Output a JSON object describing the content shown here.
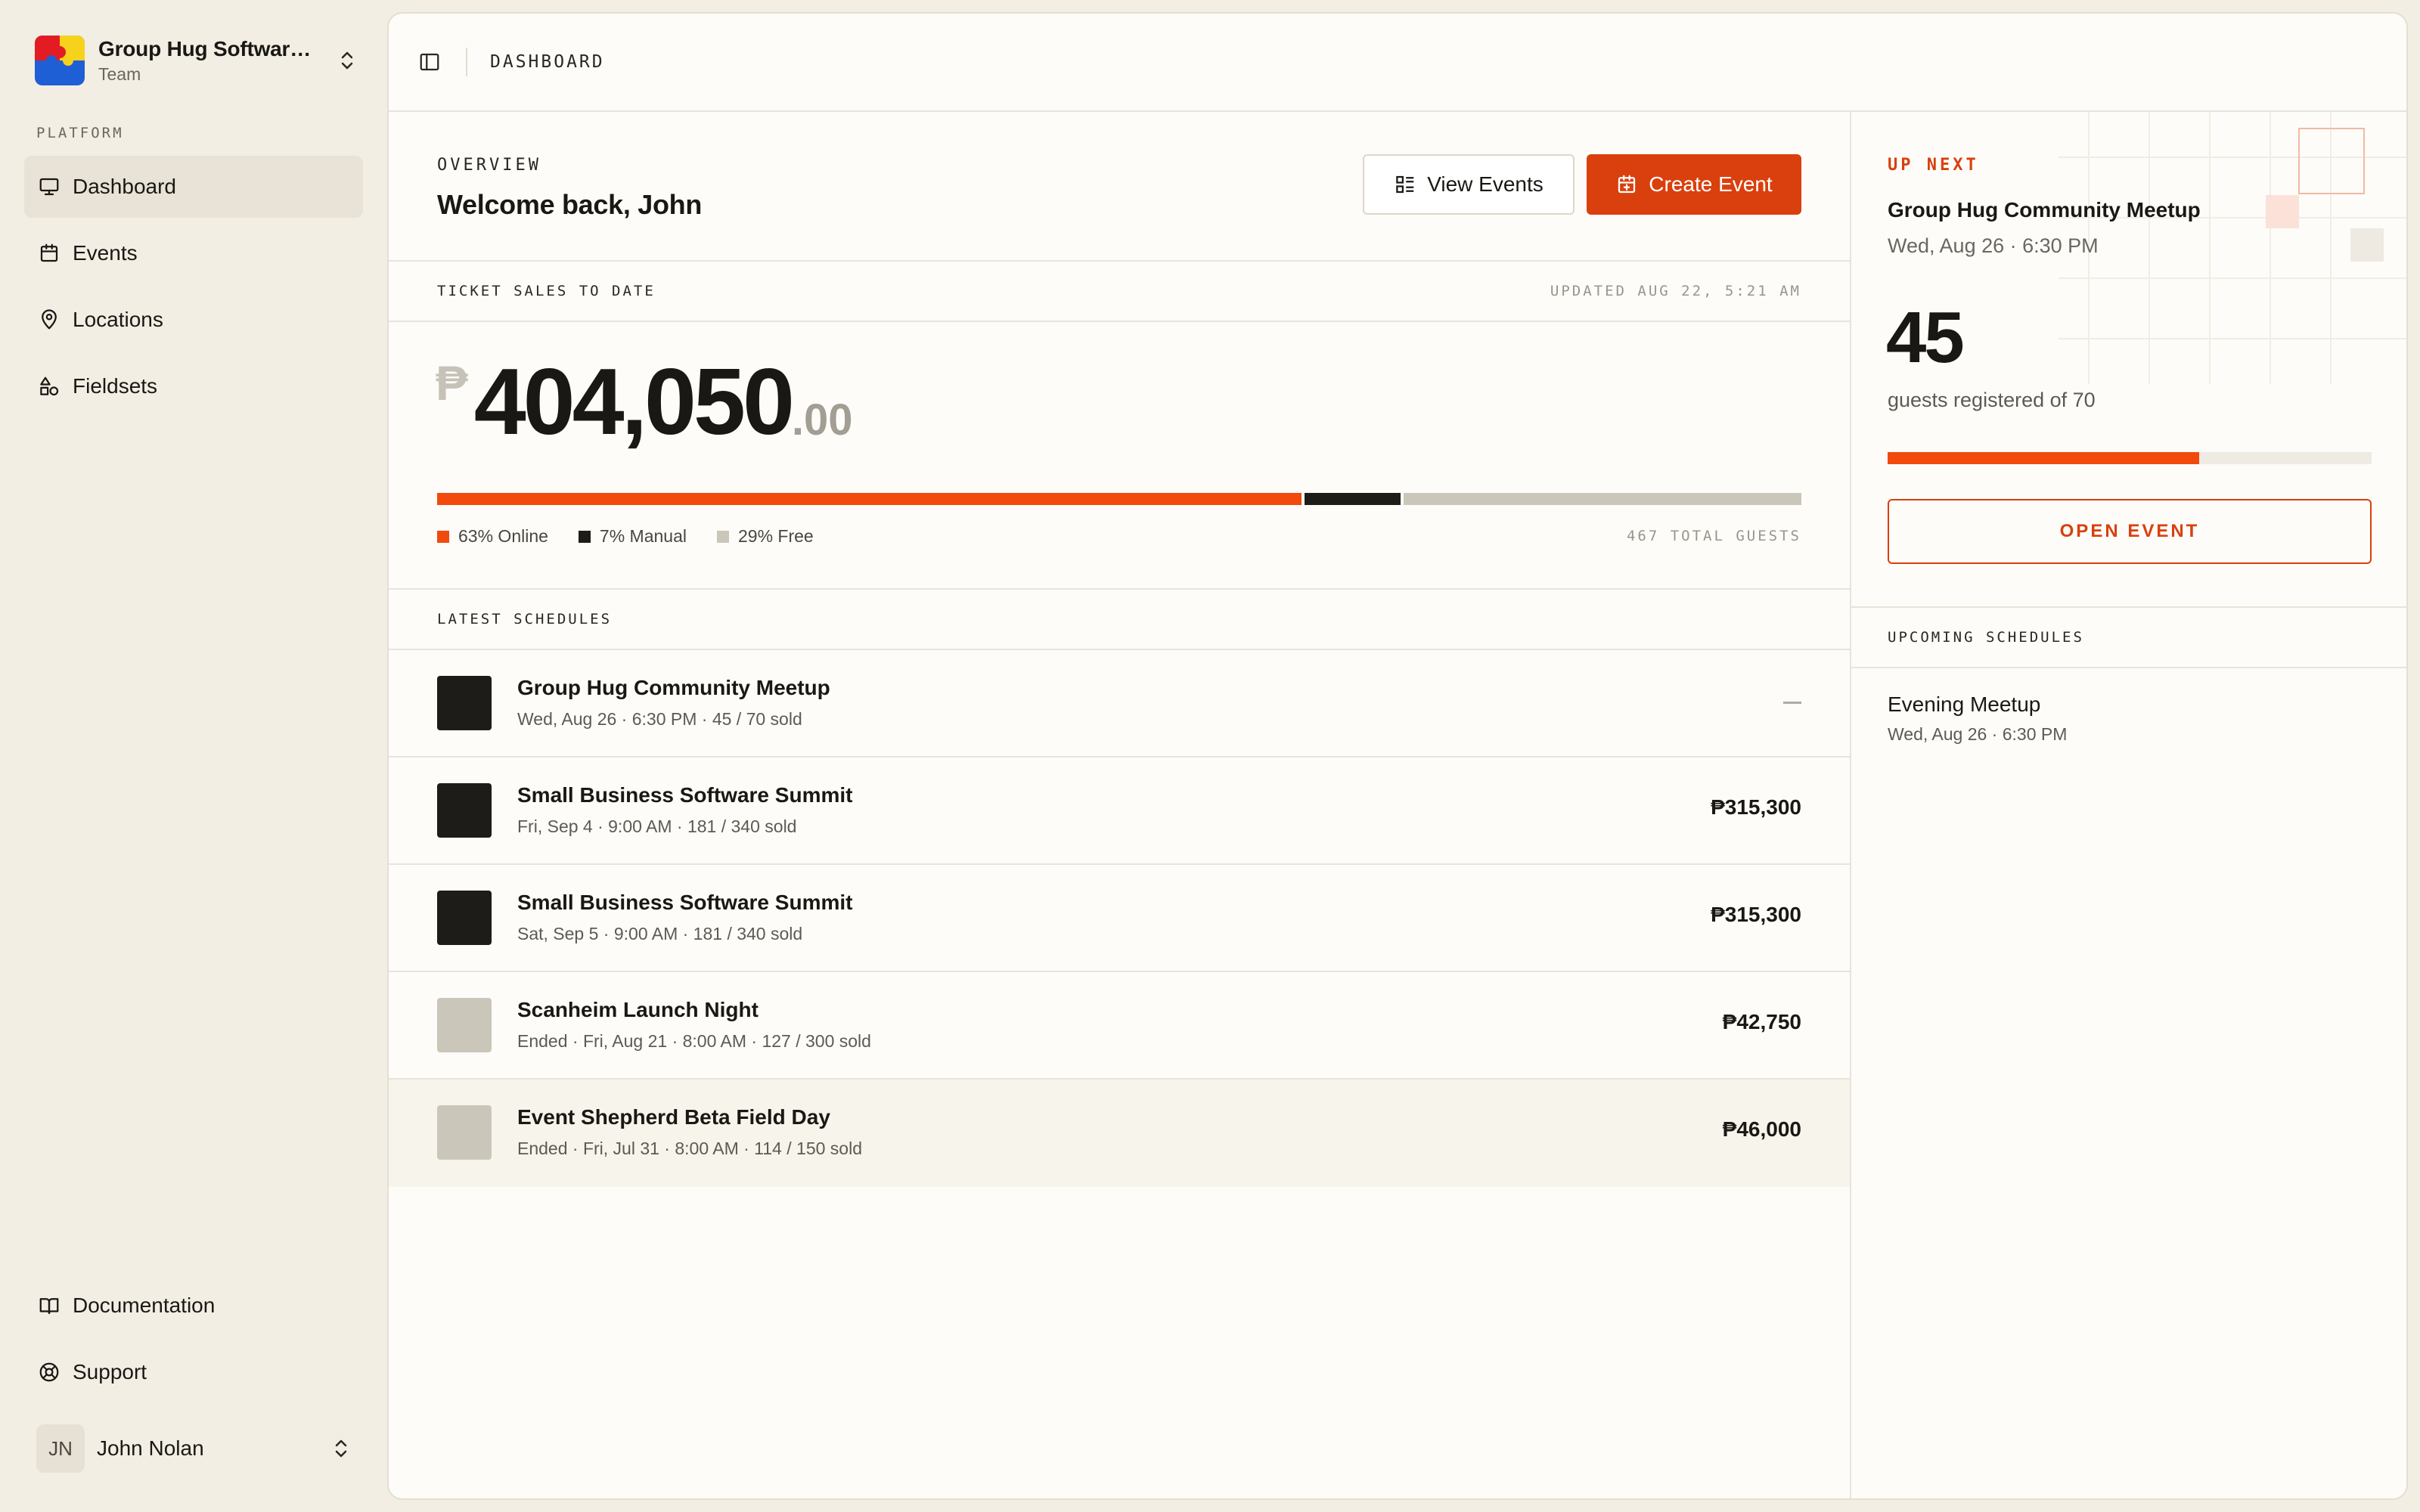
{
  "org": {
    "name": "Group Hug Software...",
    "role": "Team"
  },
  "sidebar": {
    "section": "PLATFORM",
    "items": [
      {
        "label": "Dashboard",
        "icon": "monitor-icon",
        "active": true
      },
      {
        "label": "Events",
        "icon": "calendar-icon"
      },
      {
        "label": "Locations",
        "icon": "map-pin-icon"
      },
      {
        "label": "Fieldsets",
        "icon": "shapes-icon"
      }
    ],
    "bottom": [
      {
        "label": "Documentation",
        "icon": "book-icon"
      },
      {
        "label": "Support",
        "icon": "lifebuoy-icon"
      }
    ]
  },
  "user": {
    "initials": "JN",
    "name": "John Nolan"
  },
  "topbar": {
    "breadcrumb": "DASHBOARD"
  },
  "overview": {
    "eyebrow": "OVERVIEW",
    "welcome": "Welcome back, John",
    "view_events": "View Events",
    "create_event": "Create Event"
  },
  "sales": {
    "label": "TICKET SALES TO DATE",
    "updated": "UPDATED AUG 22, 5:21 AM",
    "currency": "₱",
    "amount_int": "404,050",
    "amount_dec": ".00",
    "breakdown": [
      {
        "label": "63% Online",
        "percent": 63,
        "color": "#f24a0c"
      },
      {
        "label": "7% Manual",
        "percent": 7,
        "color": "#1e1c18"
      },
      {
        "label": "29% Free",
        "percent": 29,
        "color": "#cbc6ba"
      }
    ],
    "total_guests": "467 TOTAL GUESTS"
  },
  "schedules": {
    "label": "LATEST SCHEDULES",
    "rows": [
      {
        "title": "Group Hug Community Meetup",
        "sub": "Wed, Aug 26 · 6:30 PM · 45 / 70 sold",
        "amount": "",
        "thumb": "#1e1c18"
      },
      {
        "title": "Small Business Software Summit",
        "sub": "Fri, Sep 4 · 9:00 AM · 181 / 340 sold",
        "amount": "₱315,300",
        "thumb": "#1e1c18"
      },
      {
        "title": "Small Business Software Summit",
        "sub": "Sat, Sep 5 · 9:00 AM · 181 / 340 sold",
        "amount": "₱315,300",
        "thumb": "#1e1c18"
      },
      {
        "title": "Scanheim Launch Night",
        "sub": "Ended · Fri, Aug 21 · 8:00 AM · 127 / 300 sold",
        "amount": "₱42,750",
        "thumb": "#cbc6ba"
      },
      {
        "title": "Event Shepherd Beta Field Day",
        "sub": "Ended · Fri, Jul 31 · 8:00 AM · 114 / 150 sold",
        "amount": "₱46,000",
        "thumb": "#cbc6ba"
      }
    ]
  },
  "upnext": {
    "eyebrow": "UP NEXT",
    "title": "Group Hug Community Meetup",
    "date": "Wed, Aug 26 · 6:30 PM",
    "count": "45",
    "registered": "guests registered of 70",
    "progress": 0.643,
    "open": "OPEN EVENT"
  },
  "upcoming": {
    "label": "UPCOMING SCHEDULES",
    "items": [
      {
        "title": "Evening Meetup",
        "sub": "Wed, Aug 26 · 6:30 PM"
      }
    ]
  },
  "colors": {
    "accent": "#d9400d",
    "bar_accent": "#f24a0c"
  }
}
